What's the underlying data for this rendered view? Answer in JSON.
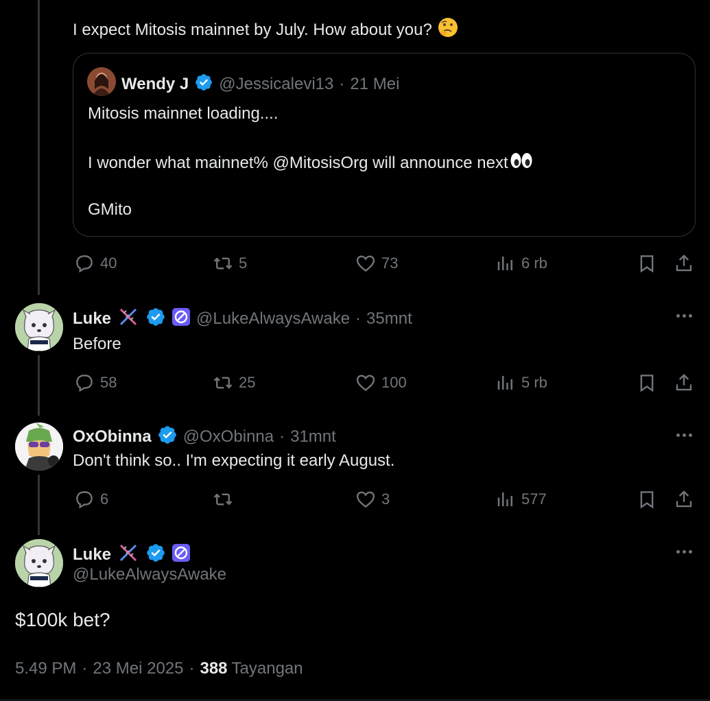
{
  "top_tweet": {
    "text": "I expect Mitosis mainnet by July. How about you?",
    "quote": {
      "name": "Wendy J",
      "handle": "@Jessicalevi13",
      "sep": "·",
      "time": "21 Mei",
      "line1": "Mitosis mainnet loading....",
      "line2": "I wonder what mainnet% @MitosisOrg will announce next",
      "line3": "GMito"
    },
    "actions": {
      "replies": "40",
      "reposts": "5",
      "likes": "73",
      "views": "6 rb"
    }
  },
  "reply1": {
    "name": "Luke",
    "handle": "@LukeAlwaysAwake",
    "sep": "·",
    "time": "35mnt",
    "text": "Before",
    "actions": {
      "replies": "58",
      "reposts": "25",
      "likes": "100",
      "views": "5 rb"
    }
  },
  "reply2": {
    "name": "OxObinna",
    "handle": "@OxObinna",
    "sep": "·",
    "time": "31mnt",
    "text": "Don't think so.. I'm expecting it early August.",
    "actions": {
      "replies": "6",
      "reposts": "",
      "likes": "3",
      "views": "577"
    }
  },
  "main_tweet": {
    "name": "Luke",
    "handle": "@LukeAlwaysAwake",
    "text": "$100k bet?",
    "time": "5.49 PM",
    "sep1": "·",
    "date": "23 Mei 2025",
    "sep2": "·",
    "views_count": "388",
    "views_label": "Tayangan"
  },
  "colors": {
    "background": "#000000",
    "text": "#e7e9ea",
    "muted": "#71767b",
    "verified": "#1d9bf0",
    "border": "#2f3336"
  }
}
